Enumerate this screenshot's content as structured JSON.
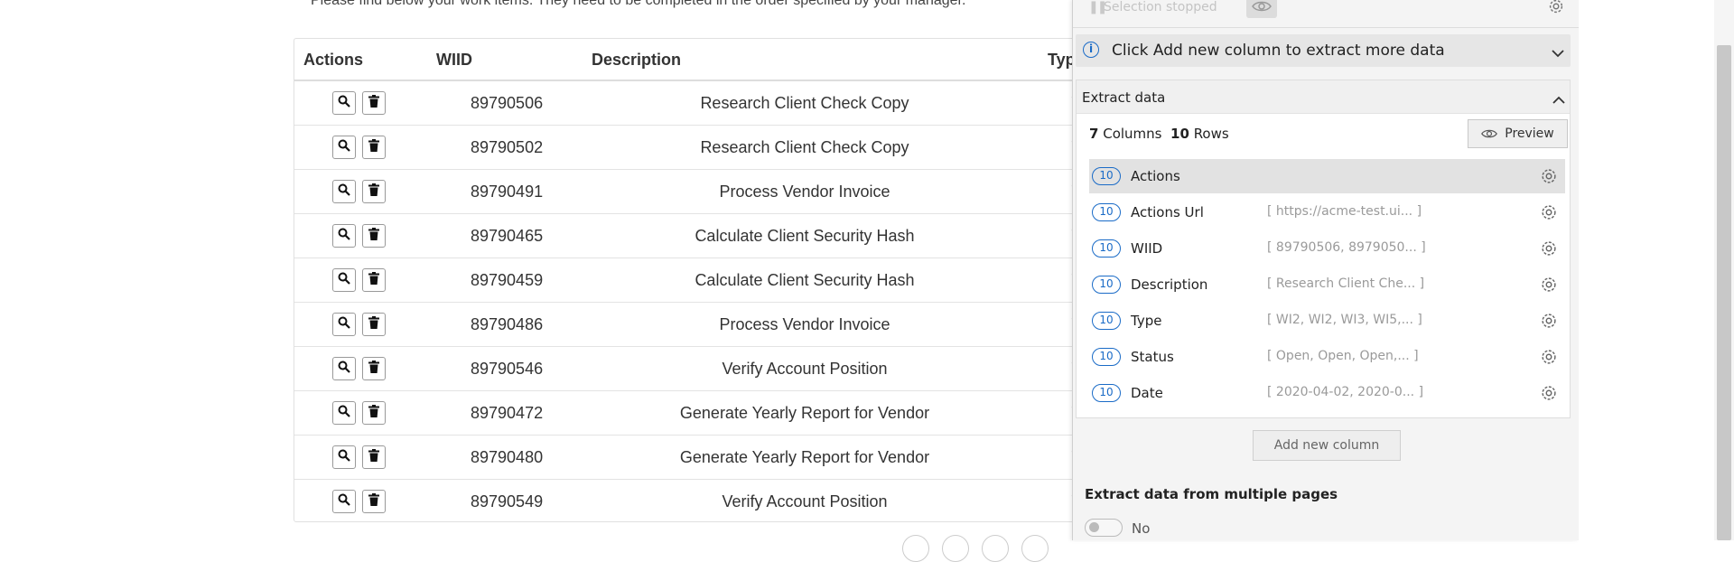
{
  "intro_text": "Please find below your work items. They need to be completed in the order specified by your manager.",
  "table": {
    "headers": {
      "actions": "Actions",
      "wiid": "WIID",
      "description": "Description",
      "type": "Typ"
    },
    "rows": [
      {
        "wiid": "89790506",
        "description": "Research Client Check Copy",
        "type": "'"
      },
      {
        "wiid": "89790502",
        "description": "Research Client Check Copy",
        "type": "'"
      },
      {
        "wiid": "89790491",
        "description": "Process Vendor Invoice",
        "type": "'"
      },
      {
        "wiid": "89790465",
        "description": "Calculate Client Security Hash",
        "type": "'"
      },
      {
        "wiid": "89790459",
        "description": "Calculate Client Security Hash",
        "type": "'"
      },
      {
        "wiid": "89790486",
        "description": "Process Vendor Invoice",
        "type": "'"
      },
      {
        "wiid": "89790546",
        "description": "Verify Account Position",
        "type": "'"
      },
      {
        "wiid": "89790472",
        "description": "Generate Yearly Report for Vendor",
        "type": "'"
      },
      {
        "wiid": "89790480",
        "description": "Generate Yearly Report for Vendor",
        "type": "'"
      },
      {
        "wiid": "89790549",
        "description": "Verify Account Position",
        "type": "'"
      }
    ],
    "icons": {
      "view": "search-icon",
      "delete": "trash-icon"
    }
  },
  "panel": {
    "selection_status": "Selection stopped",
    "info_message": "Click Add new column to extract more data",
    "extract_title": "Extract data",
    "columns_count": "7",
    "columns_label": "Columns",
    "rows_count": "10",
    "rows_label": "Rows",
    "preview_label": "Preview",
    "columns": [
      {
        "count": "10",
        "name": "Actions",
        "preview": "",
        "selected": true
      },
      {
        "count": "10",
        "name": "Actions Url",
        "preview": "[ https://acme-test.ui... ]"
      },
      {
        "count": "10",
        "name": "WIID",
        "preview": "[ 89790506, 8979050... ]"
      },
      {
        "count": "10",
        "name": "Description",
        "preview": "[ Research Client Che... ]"
      },
      {
        "count": "10",
        "name": "Type",
        "preview": "[ WI2, WI2, WI3, WI5,... ]"
      },
      {
        "count": "10",
        "name": "Status",
        "preview": "[ Open, Open, Open,... ]"
      },
      {
        "count": "10",
        "name": "Date",
        "preview": "[ 2020-04-02, 2020-0... ]"
      }
    ],
    "add_column_label": "Add new column",
    "multi_page_label": "Extract data from multiple pages",
    "toggle_label": "No",
    "colors": {
      "accent": "#1a6bc7"
    }
  }
}
